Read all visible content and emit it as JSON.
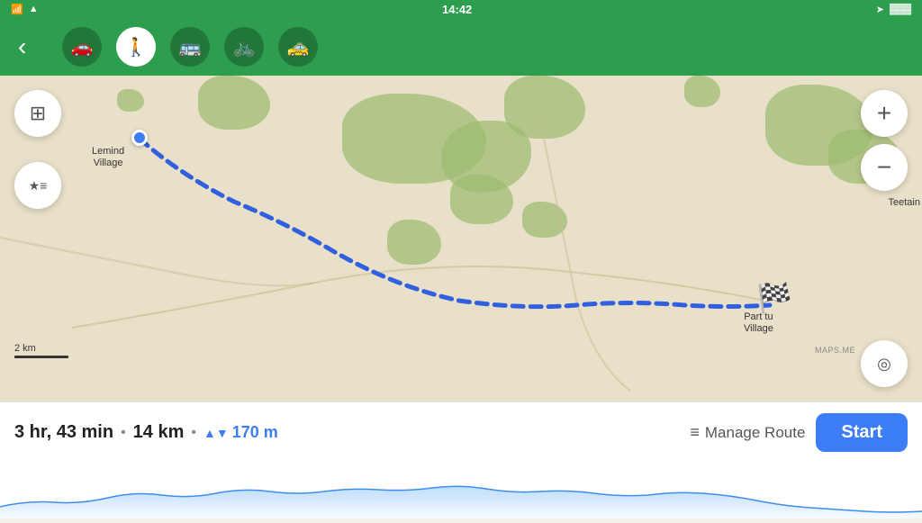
{
  "status_bar": {
    "time": "14:42",
    "wifi_icon": "wifi",
    "signal_icon": "signal",
    "location_icon": "➤",
    "battery_icon": "🔋"
  },
  "nav": {
    "back_label": "‹",
    "transport_modes": [
      {
        "id": "car",
        "icon": "🚗",
        "active": false,
        "label": "car-mode"
      },
      {
        "id": "walk",
        "icon": "🚶",
        "active": true,
        "label": "walk-mode"
      },
      {
        "id": "transit",
        "icon": "🚌",
        "active": false,
        "label": "transit-mode"
      },
      {
        "id": "bike",
        "icon": "🚲",
        "active": false,
        "label": "bike-mode"
      },
      {
        "id": "taxi",
        "icon": "🚕",
        "active": false,
        "label": "taxi-mode"
      }
    ]
  },
  "map": {
    "origin_label": "Lemind\nVillage",
    "destination_label": "Part tu\nVillage",
    "destination_label2": "Teetain",
    "scale_label": "2 km",
    "watermark": "MAPS.ME"
  },
  "map_controls": {
    "zoom_in": "+",
    "zoom_out": "−",
    "location": "◎"
  },
  "route_info": {
    "time": "3 hr, 43 min",
    "separator1": "•",
    "distance": "14 km",
    "separator2": "•",
    "elevation": "170 m",
    "manage_route_label": "Manage Route",
    "start_label": "Start"
  }
}
